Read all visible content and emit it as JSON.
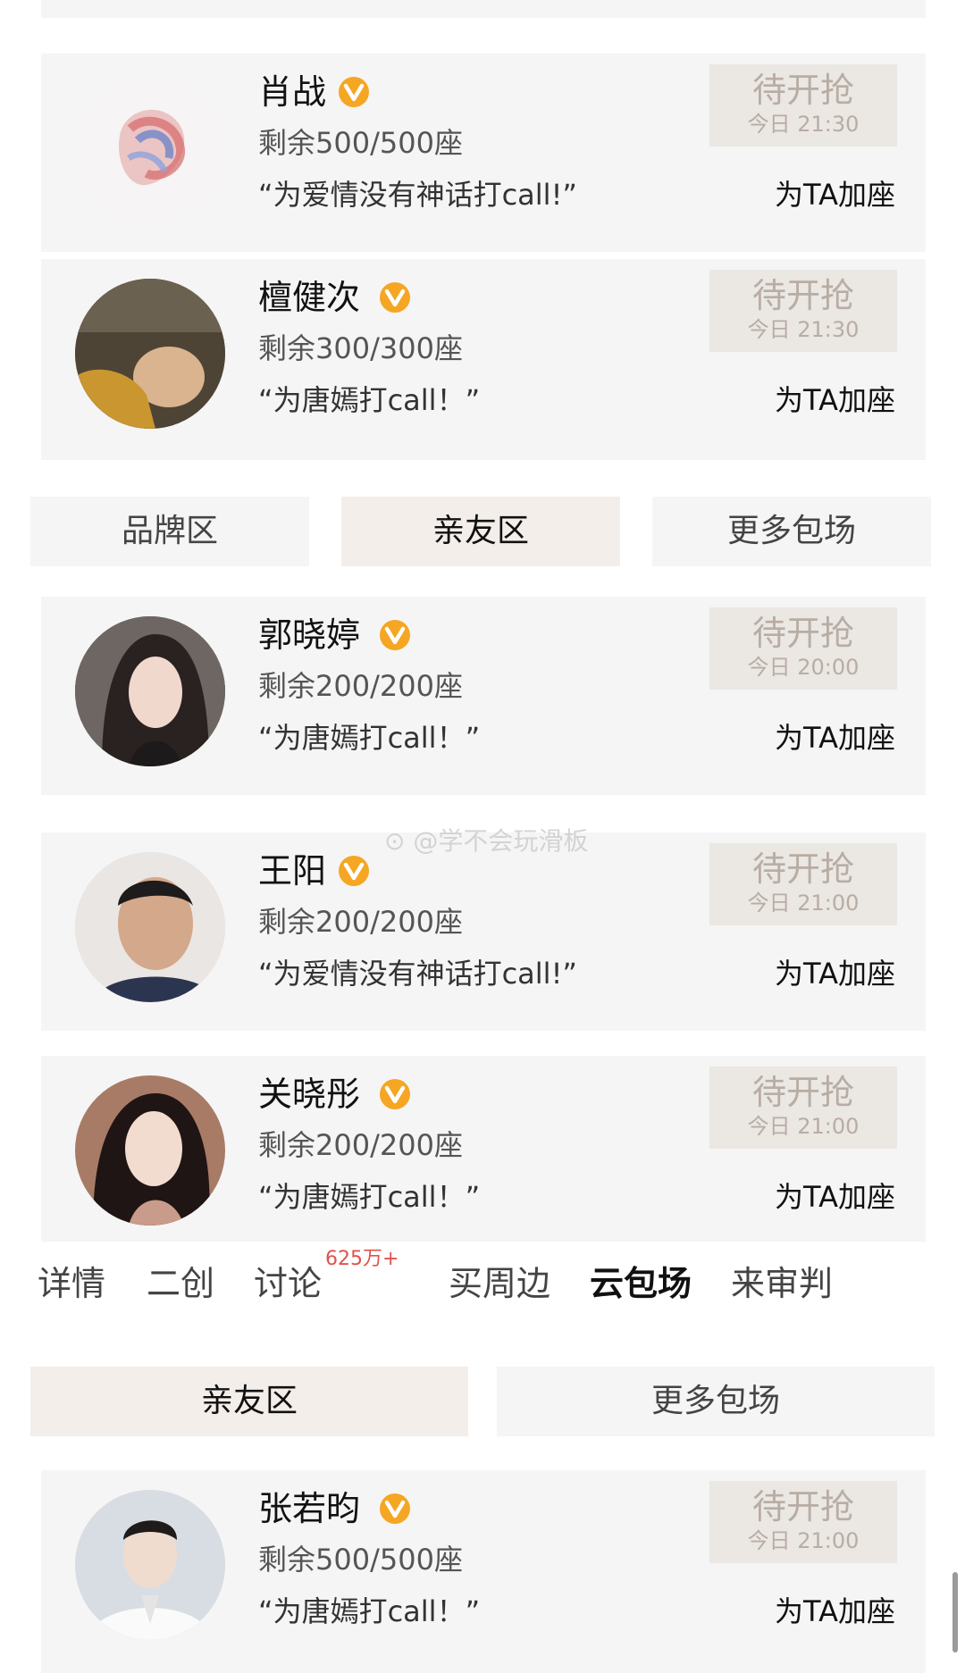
{
  "cards": [
    {
      "name": "肖战",
      "seats": "剩余500/500座",
      "slogan": "“为爱情没有神话打call!”",
      "status": "待开抢",
      "time": "今日 21:30",
      "add": "为TA加座",
      "avatar_icon": "heart-art-avatar-icon"
    },
    {
      "name": "檀健次",
      "seats": "剩余300/300座",
      "slogan": "“为唐嫣打call！”",
      "status": "待开抢",
      "time": "今日 21:30",
      "add": "为TA加座",
      "avatar_icon": "person-avatar-icon"
    },
    {
      "name": "郭晓婷",
      "seats": "剩余200/200座",
      "slogan": "“为唐嫣打call！”",
      "status": "待开抢",
      "time": "今日 20:00",
      "add": "为TA加座",
      "avatar_icon": "person-avatar-icon"
    },
    {
      "name": "王阳",
      "seats": "剩余200/200座",
      "slogan": "“为爱情没有神话打call!”",
      "status": "待开抢",
      "time": "今日 21:00",
      "add": "为TA加座",
      "avatar_icon": "person-avatar-icon"
    },
    {
      "name": "关晓彤",
      "seats": "剩余200/200座",
      "slogan": "“为唐嫣打call！”",
      "status": "待开抢",
      "time": "今日 21:00",
      "add": "为TA加座",
      "avatar_icon": "person-avatar-icon"
    },
    {
      "name": "张若昀",
      "seats": "剩余500/500座",
      "slogan": "“为唐嫣打call！”",
      "status": "待开抢",
      "time": "今日 21:00",
      "add": "为TA加座",
      "avatar_icon": "person-avatar-icon"
    }
  ],
  "segment1": {
    "brand": "品牌区",
    "friends": "亲友区",
    "more": "更多包场"
  },
  "segment2": {
    "friends": "亲友区",
    "more": "更多包场"
  },
  "nav": {
    "details": "详情",
    "fanart": "二创",
    "discuss": "讨论",
    "discuss_count": "625万+",
    "merch": "买周边",
    "cloud": "云包场",
    "judge": "来审判"
  },
  "watermark": "@学不会玩滑板",
  "colors": {
    "verified_badge": "#f5a623",
    "grab_bg": "#ebe7e3",
    "grab_text": "#b8ada4",
    "count_badge": "#e0524a"
  }
}
